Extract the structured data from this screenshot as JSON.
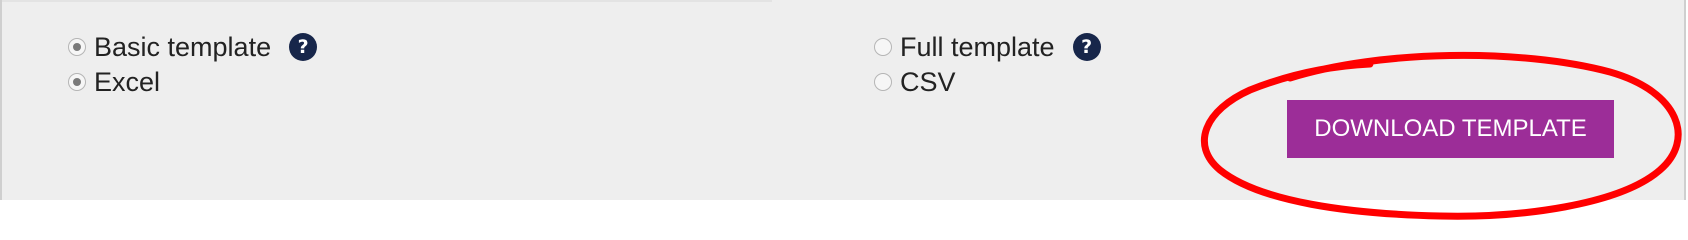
{
  "template_type": {
    "basic": {
      "label": "Basic template",
      "checked": true,
      "help_icon": "question-circle-icon"
    },
    "full": {
      "label": "Full template",
      "checked": false,
      "help_icon": "question-circle-icon"
    }
  },
  "file_format": {
    "excel": {
      "label": "Excel",
      "checked": true
    },
    "csv": {
      "label": "CSV",
      "checked": false
    }
  },
  "help_glyph": "?",
  "download_button": {
    "label": "DOWNLOAD TEMPLATE"
  },
  "colors": {
    "panel_bg": "#eeeeee",
    "button_bg": "#9c2d98",
    "help_icon_bg": "#17264a",
    "highlight_annotation": "#ff0000"
  }
}
